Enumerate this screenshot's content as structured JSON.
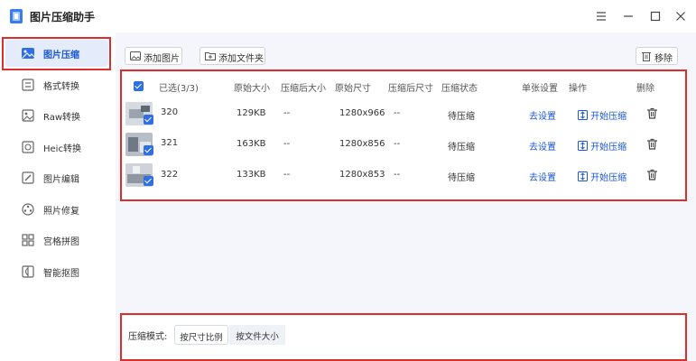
{
  "app": {
    "title": "图片压缩助手"
  },
  "sidebar": {
    "items": [
      {
        "label": "图片压缩",
        "icon": "image-compress-icon",
        "active": true
      },
      {
        "label": "格式转换",
        "icon": "format-convert-icon"
      },
      {
        "label": "Raw转换",
        "icon": "raw-convert-icon"
      },
      {
        "label": "Heic转换",
        "icon": "heic-convert-icon"
      },
      {
        "label": "图片编辑",
        "icon": "image-edit-icon"
      },
      {
        "label": "照片修复",
        "icon": "photo-repair-icon"
      },
      {
        "label": "宫格拼图",
        "icon": "grid-collage-icon"
      },
      {
        "label": "智能抠图",
        "icon": "smart-cutout-icon"
      }
    ]
  },
  "toolbar": {
    "add_image": "添加图片",
    "add_folder": "添加文件夹",
    "remove": "移除"
  },
  "table": {
    "selected": "已选(3/3)",
    "headers": {
      "orig_size": "原始大小",
      "comp_size": "压缩后大小",
      "orig_dim": "原始尺寸",
      "comp_dim": "压缩后尺寸",
      "status": "压缩状态",
      "single": "单张设置",
      "action": "操作",
      "delete": "删除"
    },
    "rows": [
      {
        "name": "320",
        "orig_size": "129KB",
        "comp_size": "--",
        "orig_dim": "1280x966",
        "comp_dim": "--",
        "status": "待压缩",
        "settings": "去设置",
        "start": "开始压缩"
      },
      {
        "name": "321",
        "orig_size": "163KB",
        "comp_size": "--",
        "orig_dim": "1280x856",
        "comp_dim": "--",
        "status": "待压缩",
        "settings": "去设置",
        "start": "开始压缩"
      },
      {
        "name": "322",
        "orig_size": "133KB",
        "comp_size": "--",
        "orig_dim": "1280x853",
        "comp_dim": "--",
        "status": "待压缩",
        "settings": "去设置",
        "start": "开始压缩"
      }
    ]
  },
  "compress": {
    "mode_label": "压缩模式:",
    "options": [
      "按尺寸比例",
      "按文件大小"
    ],
    "selected": "按尺寸比例"
  },
  "colors": {
    "accent": "#1b56d8",
    "highlight": "#d9302e",
    "check": "#2f6fe4"
  }
}
